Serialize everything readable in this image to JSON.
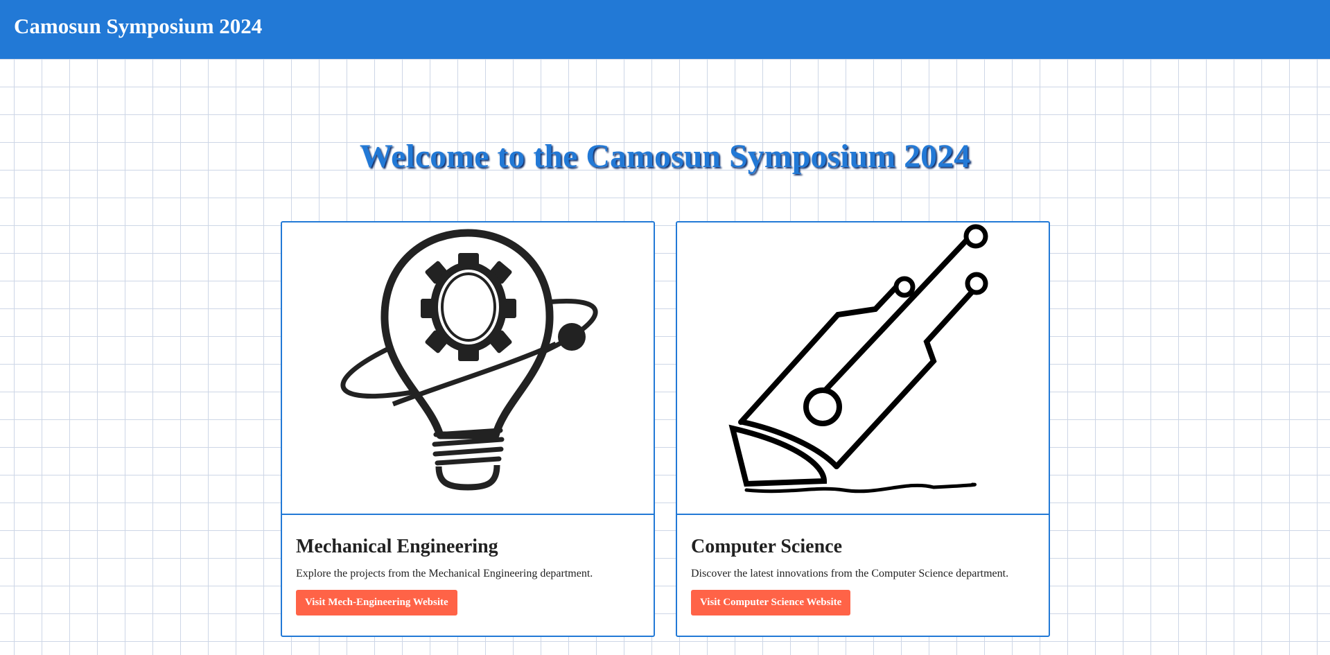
{
  "header": {
    "title": "Camosun Symposium 2024"
  },
  "main": {
    "welcome": "Welcome to the Camosun Symposium 2024",
    "cards": [
      {
        "title": "Mechanical Engineering",
        "description": "Explore the projects from the Mechanical Engineering department.",
        "button_label": "Visit Mech-Engineering Website",
        "icon": "lightbulb-gear-icon"
      },
      {
        "title": "Computer Science",
        "description": "Discover the latest innovations from the Computer Science department.",
        "button_label": "Visit Computer Science Website",
        "icon": "circuit-pen-icon"
      }
    ]
  },
  "colors": {
    "header_bg": "#2279d6",
    "accent": "#2279d6",
    "button_bg": "#ff6347",
    "grid_line": "#cdd6e6"
  }
}
